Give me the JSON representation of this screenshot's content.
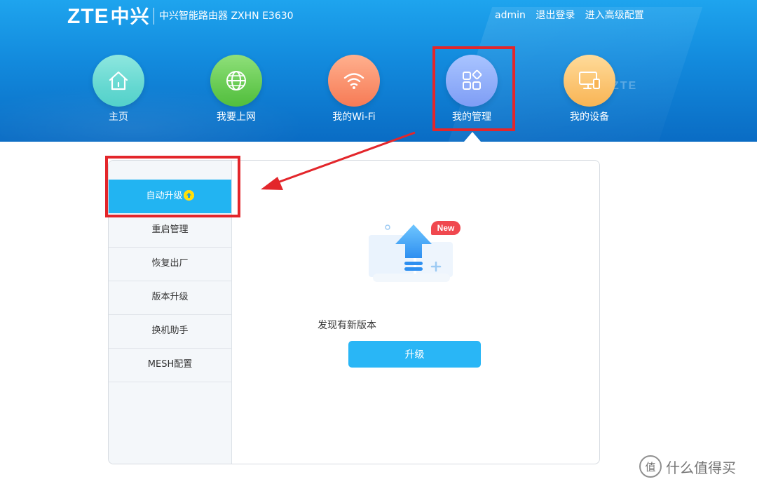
{
  "header": {
    "logo": "ZTE",
    "logo_cn": "中兴",
    "product": "中兴智能路由器 ZXHN E3630",
    "user": "admin",
    "logout": "退出登录",
    "advanced": "进入高级配置",
    "bg_word": "ZTE"
  },
  "nav": [
    {
      "label": "主页",
      "icon": "home-icon",
      "color": "#5fd6cf"
    },
    {
      "label": "我要上网",
      "icon": "globe-icon",
      "color": "#62c84d"
    },
    {
      "label": "我的Wi-Fi",
      "icon": "wifi-icon",
      "color": "#f88d69"
    },
    {
      "label": "我的管理",
      "icon": "grid-icon",
      "color": "#8eabf7",
      "selected": true
    },
    {
      "label": "我的设备",
      "icon": "monitor-icon",
      "color": "#fbc368"
    }
  ],
  "sidebar": {
    "items": [
      {
        "label": "自动升级",
        "active": true
      },
      {
        "label": "重启管理"
      },
      {
        "label": "恢复出厂"
      },
      {
        "label": "版本升级"
      },
      {
        "label": "换机助手"
      },
      {
        "label": "MESH配置"
      }
    ]
  },
  "content": {
    "new_badge": "New",
    "message": "发现有新版本",
    "button": "升级"
  },
  "watermark": {
    "glyph": "值",
    "text": "什么值得买"
  },
  "colors": {
    "header": "#1289dc",
    "accent": "#29b6f6",
    "highlight": "#e3262b",
    "new_badge": "#f0484f"
  }
}
